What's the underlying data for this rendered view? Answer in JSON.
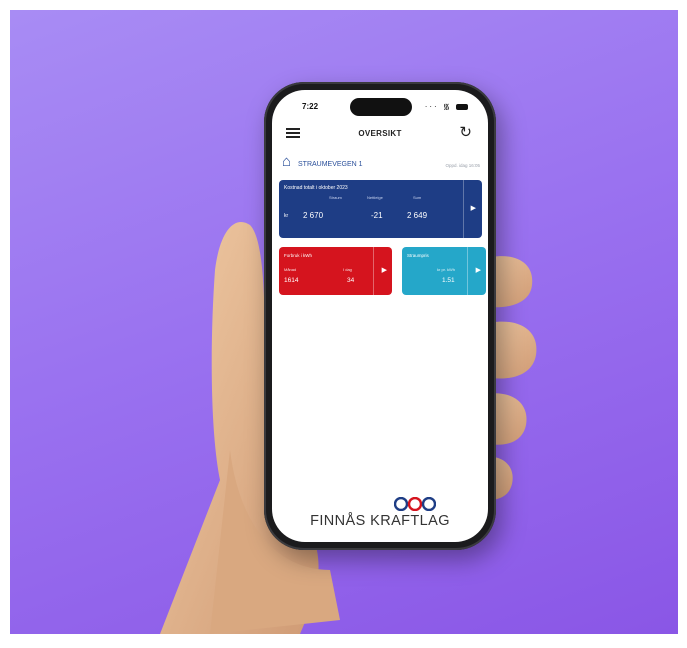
{
  "status_bar": {
    "time": "7:22"
  },
  "header": {
    "title": "OVERSIKT",
    "menu_icon": "menu-icon",
    "refresh_icon": "refresh-icon"
  },
  "location": {
    "address": "STRAUMEVEGEN 1",
    "updated": "Oppd. idag 16:05",
    "home_icon": "home-icon"
  },
  "cards": {
    "main": {
      "title": "Kostnad totalt i oktober 2023",
      "columns": [
        "Straum",
        "Nettleige",
        "Sum"
      ],
      "unit": "kr",
      "values": [
        "2 670",
        "-21",
        "2 649"
      ],
      "color": "#1e3d85"
    },
    "forbruk": {
      "title": "Forbruk i kWh",
      "label_left": "Månad",
      "label_right": "I dag",
      "value_left": "1614",
      "value_right": "34",
      "color": "#d5141e"
    },
    "straumpris": {
      "title": "Straumpris",
      "label": "kr pr. kWh",
      "value": "1.51",
      "color": "#25a7c9"
    }
  },
  "logo": {
    "text": "FINNÅS KRAFTLAG"
  }
}
